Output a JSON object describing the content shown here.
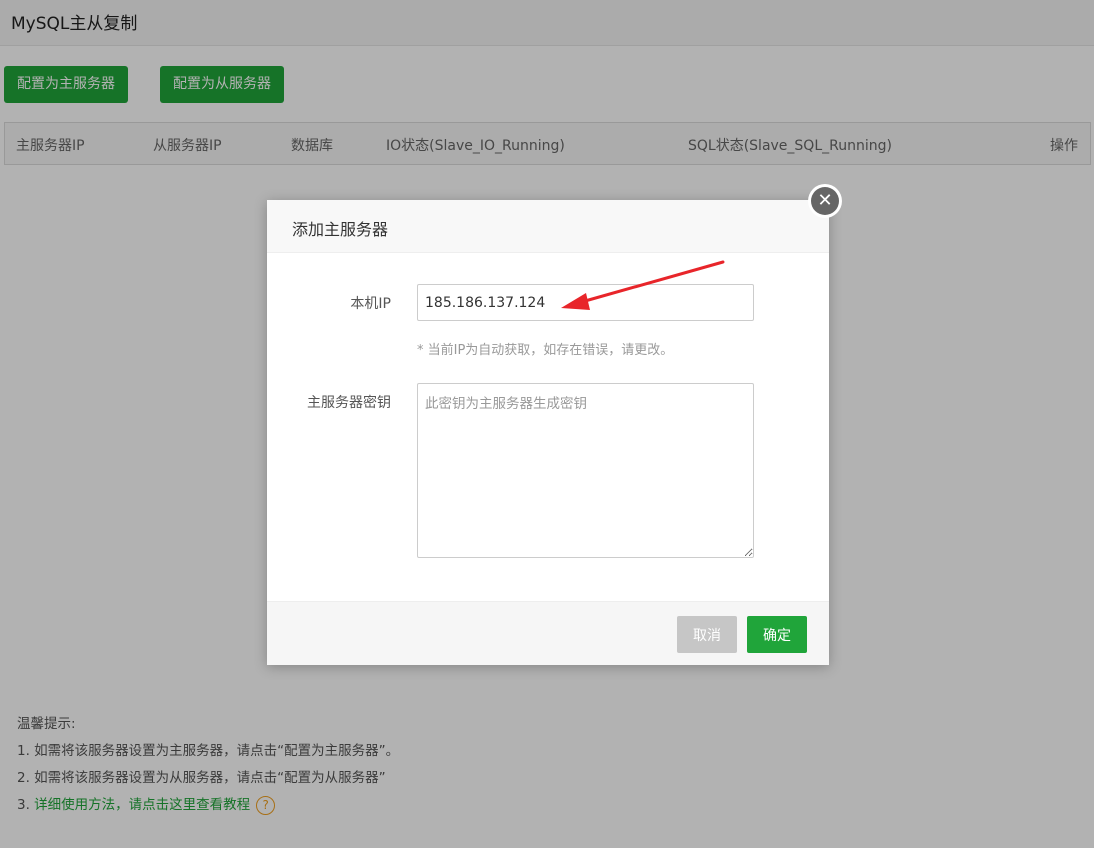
{
  "page": {
    "title": "MySQL主从复制"
  },
  "toolbar": {
    "master_label": "配置为主服务器",
    "slave_label": "配置为从服务器"
  },
  "table": {
    "columns": [
      "主服务器IP",
      "从服务器IP",
      "数据库",
      "IO状态(Slave_IO_Running)",
      "SQL状态(Slave_SQL_Running)",
      "操作"
    ]
  },
  "tips": {
    "heading": "温馨提示:",
    "line1": "1. 如需将该服务器设置为主服务器，请点击“配置为主服务器”。",
    "line2": "2. 如需将该服务器设置为从服务器，请点击“配置为从服务器”",
    "line3_prefix": "3. ",
    "line3_link": "详细使用方法，请点击这里查看教程",
    "help_icon": "question-circle-icon"
  },
  "modal": {
    "title": "添加主服务器",
    "close_icon": "close-icon",
    "ip_label": "本机IP",
    "ip_value": "185.186.137.124",
    "ip_hint": "* 当前IP为自动获取，如存在错误，请更改。",
    "key_label": "主服务器密钥",
    "key_placeholder": "此密钥为主服务器生成密钥",
    "cancel_label": "取消",
    "ok_label": "确定"
  },
  "colors": {
    "accent": "#20a53a",
    "annotation_arrow": "#e8252a",
    "help_icon": "#f0a020"
  }
}
